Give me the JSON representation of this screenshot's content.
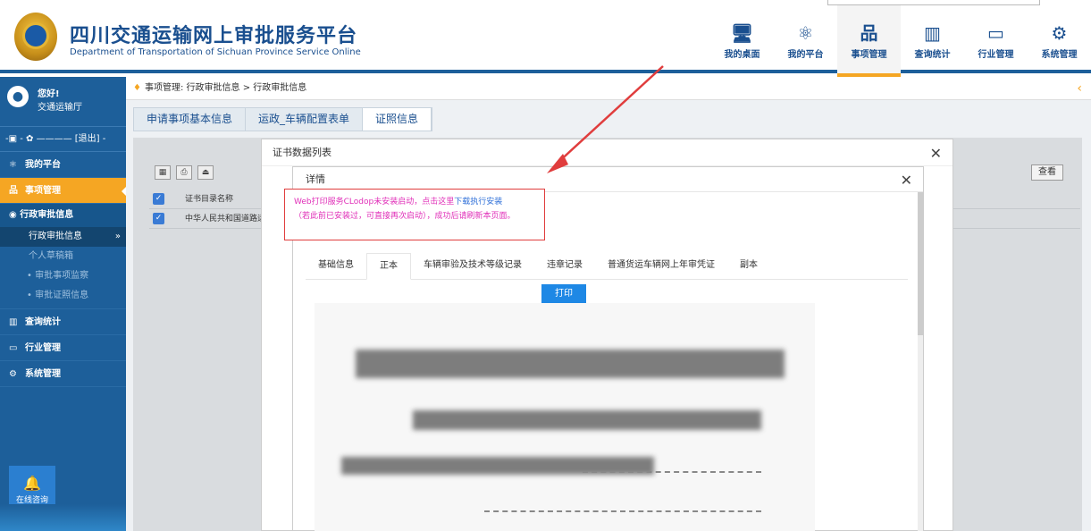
{
  "header": {
    "title": "四川交通运输网上审批服务平台",
    "subtitle": "Department of Transportation of Sichuan Province Service Online",
    "nav": [
      {
        "label": "我的桌面",
        "icon": "desktop-icon",
        "glyph": "🖥"
      },
      {
        "label": "我的平台",
        "icon": "atom-icon",
        "glyph": "⚛"
      },
      {
        "label": "事项管理",
        "icon": "sitemap-icon",
        "glyph": "品"
      },
      {
        "label": "查询统计",
        "icon": "bar-chart-icon",
        "glyph": "▥"
      },
      {
        "label": "行业管理",
        "icon": "document-icon",
        "glyph": "▭"
      },
      {
        "label": "系统管理",
        "icon": "gear-icon",
        "glyph": "⚙"
      }
    ],
    "active_nav": "事项管理"
  },
  "sidebar": {
    "greeting": "您好!",
    "org": "交通运输厅",
    "controls": "-▣ - ✿ ———— [退出] -",
    "menu": {
      "platform": "我的平台",
      "items_mgmt": "事项管理",
      "admin_info": "行政审批信息",
      "admin_info_sub": "行政审批信息",
      "personal": "个人草稿箱",
      "supervision": "审批事项监察",
      "certificates": "审批证照信息",
      "query": "查询统计",
      "industry": "行业管理",
      "system": "系统管理"
    },
    "chat_label": "在线咨询"
  },
  "main": {
    "breadcrumb": "事项管理:  行政审批信息  >  行政审批信息",
    "tabs": [
      "申请事项基本信息",
      "运政_车辆配置表单",
      "证照信息"
    ],
    "active_tab": "证照信息",
    "view_button": "查看",
    "table_header": "证书目录名称",
    "table_row": "中华人民共和国道路运"
  },
  "modal_outer": {
    "title": "证书数据列表"
  },
  "modal_detail": {
    "title": "详情",
    "warning_line1_a": "Web打印服务CLodop未安装启动，点击这里",
    "warning_line1_b": "下载执行安装",
    "warning_line2": "（若此前已安装过，可直接再次启动），成功后请刷新本页面。",
    "tabs": [
      "基础信息",
      "正本",
      "车辆审验及技术等级记录",
      "违章记录",
      "普通货运车辆网上年审凭证",
      "副本"
    ],
    "active_tab": "正本",
    "print_button": "打印"
  },
  "colors": {
    "primary": "#1d5f9a",
    "accent": "#f5a623",
    "warning_text": "#e02fb8",
    "highlight_box": "#e03d3d",
    "print_button": "#1e88e5"
  }
}
